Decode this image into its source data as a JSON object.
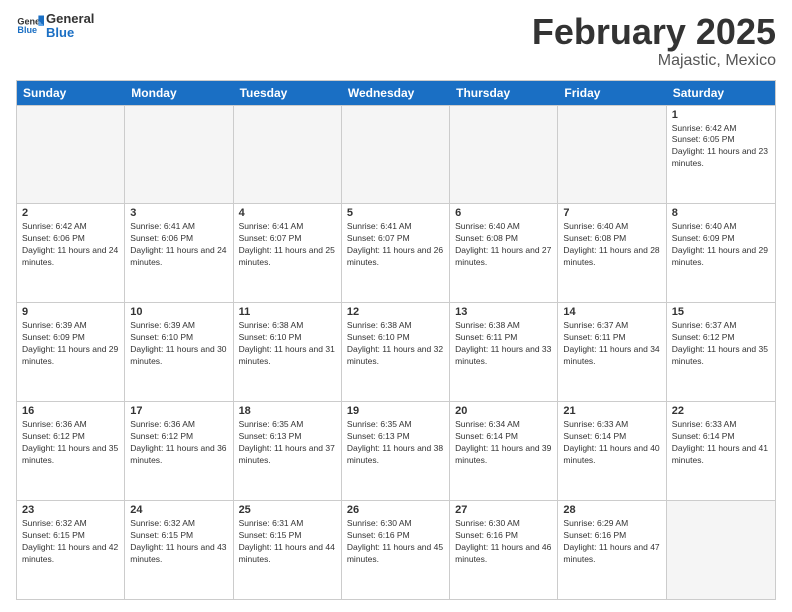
{
  "logo": {
    "text_general": "General",
    "text_blue": "Blue"
  },
  "header": {
    "title": "February 2025",
    "subtitle": "Majastic, Mexico"
  },
  "days_of_week": [
    "Sunday",
    "Monday",
    "Tuesday",
    "Wednesday",
    "Thursday",
    "Friday",
    "Saturday"
  ],
  "weeks": [
    [
      {
        "day": "",
        "info": ""
      },
      {
        "day": "",
        "info": ""
      },
      {
        "day": "",
        "info": ""
      },
      {
        "day": "",
        "info": ""
      },
      {
        "day": "",
        "info": ""
      },
      {
        "day": "",
        "info": ""
      },
      {
        "day": "1",
        "info": "Sunrise: 6:42 AM\nSunset: 6:05 PM\nDaylight: 11 hours and 23 minutes."
      }
    ],
    [
      {
        "day": "2",
        "info": "Sunrise: 6:42 AM\nSunset: 6:06 PM\nDaylight: 11 hours and 24 minutes."
      },
      {
        "day": "3",
        "info": "Sunrise: 6:41 AM\nSunset: 6:06 PM\nDaylight: 11 hours and 24 minutes."
      },
      {
        "day": "4",
        "info": "Sunrise: 6:41 AM\nSunset: 6:07 PM\nDaylight: 11 hours and 25 minutes."
      },
      {
        "day": "5",
        "info": "Sunrise: 6:41 AM\nSunset: 6:07 PM\nDaylight: 11 hours and 26 minutes."
      },
      {
        "day": "6",
        "info": "Sunrise: 6:40 AM\nSunset: 6:08 PM\nDaylight: 11 hours and 27 minutes."
      },
      {
        "day": "7",
        "info": "Sunrise: 6:40 AM\nSunset: 6:08 PM\nDaylight: 11 hours and 28 minutes."
      },
      {
        "day": "8",
        "info": "Sunrise: 6:40 AM\nSunset: 6:09 PM\nDaylight: 11 hours and 29 minutes."
      }
    ],
    [
      {
        "day": "9",
        "info": "Sunrise: 6:39 AM\nSunset: 6:09 PM\nDaylight: 11 hours and 29 minutes."
      },
      {
        "day": "10",
        "info": "Sunrise: 6:39 AM\nSunset: 6:10 PM\nDaylight: 11 hours and 30 minutes."
      },
      {
        "day": "11",
        "info": "Sunrise: 6:38 AM\nSunset: 6:10 PM\nDaylight: 11 hours and 31 minutes."
      },
      {
        "day": "12",
        "info": "Sunrise: 6:38 AM\nSunset: 6:10 PM\nDaylight: 11 hours and 32 minutes."
      },
      {
        "day": "13",
        "info": "Sunrise: 6:38 AM\nSunset: 6:11 PM\nDaylight: 11 hours and 33 minutes."
      },
      {
        "day": "14",
        "info": "Sunrise: 6:37 AM\nSunset: 6:11 PM\nDaylight: 11 hours and 34 minutes."
      },
      {
        "day": "15",
        "info": "Sunrise: 6:37 AM\nSunset: 6:12 PM\nDaylight: 11 hours and 35 minutes."
      }
    ],
    [
      {
        "day": "16",
        "info": "Sunrise: 6:36 AM\nSunset: 6:12 PM\nDaylight: 11 hours and 35 minutes."
      },
      {
        "day": "17",
        "info": "Sunrise: 6:36 AM\nSunset: 6:12 PM\nDaylight: 11 hours and 36 minutes."
      },
      {
        "day": "18",
        "info": "Sunrise: 6:35 AM\nSunset: 6:13 PM\nDaylight: 11 hours and 37 minutes."
      },
      {
        "day": "19",
        "info": "Sunrise: 6:35 AM\nSunset: 6:13 PM\nDaylight: 11 hours and 38 minutes."
      },
      {
        "day": "20",
        "info": "Sunrise: 6:34 AM\nSunset: 6:14 PM\nDaylight: 11 hours and 39 minutes."
      },
      {
        "day": "21",
        "info": "Sunrise: 6:33 AM\nSunset: 6:14 PM\nDaylight: 11 hours and 40 minutes."
      },
      {
        "day": "22",
        "info": "Sunrise: 6:33 AM\nSunset: 6:14 PM\nDaylight: 11 hours and 41 minutes."
      }
    ],
    [
      {
        "day": "23",
        "info": "Sunrise: 6:32 AM\nSunset: 6:15 PM\nDaylight: 11 hours and 42 minutes."
      },
      {
        "day": "24",
        "info": "Sunrise: 6:32 AM\nSunset: 6:15 PM\nDaylight: 11 hours and 43 minutes."
      },
      {
        "day": "25",
        "info": "Sunrise: 6:31 AM\nSunset: 6:15 PM\nDaylight: 11 hours and 44 minutes."
      },
      {
        "day": "26",
        "info": "Sunrise: 6:30 AM\nSunset: 6:16 PM\nDaylight: 11 hours and 45 minutes."
      },
      {
        "day": "27",
        "info": "Sunrise: 6:30 AM\nSunset: 6:16 PM\nDaylight: 11 hours and 46 minutes."
      },
      {
        "day": "28",
        "info": "Sunrise: 6:29 AM\nSunset: 6:16 PM\nDaylight: 11 hours and 47 minutes."
      },
      {
        "day": "",
        "info": ""
      }
    ]
  ]
}
